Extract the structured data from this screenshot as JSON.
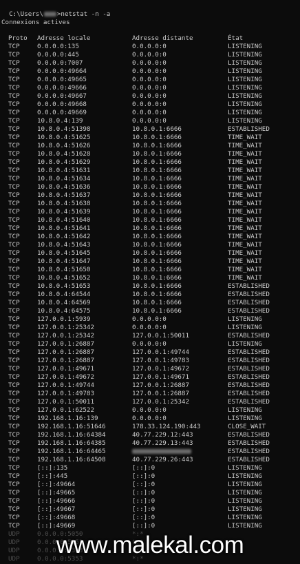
{
  "prompt": {
    "path_start": "C:\\Users\\",
    "path_end": ">",
    "command": "netstat -n -a"
  },
  "section_title": "Connexions actives",
  "headers": {
    "proto": "Proto",
    "local": "Adresse locale",
    "remote": "Adresse distante",
    "state": "État"
  },
  "rows": [
    [
      "TCP",
      "0.0.0.0:135",
      "0.0.0.0:0",
      "LISTENING"
    ],
    [
      "TCP",
      "0.0.0.0:445",
      "0.0.0.0:0",
      "LISTENING"
    ],
    [
      "TCP",
      "0.0.0.0:7007",
      "0.0.0.0:0",
      "LISTENING"
    ],
    [
      "TCP",
      "0.0.0.0:49664",
      "0.0.0.0:0",
      "LISTENING"
    ],
    [
      "TCP",
      "0.0.0.0:49665",
      "0.0.0.0:0",
      "LISTENING"
    ],
    [
      "TCP",
      "0.0.0.0:49666",
      "0.0.0.0:0",
      "LISTENING"
    ],
    [
      "TCP",
      "0.0.0.0:49667",
      "0.0.0.0:0",
      "LISTENING"
    ],
    [
      "TCP",
      "0.0.0.0:49668",
      "0.0.0.0:0",
      "LISTENING"
    ],
    [
      "TCP",
      "0.0.0.0:49669",
      "0.0.0.0:0",
      "LISTENING"
    ],
    [
      "TCP",
      "10.8.0.4:139",
      "0.0.0.0:0",
      "LISTENING"
    ],
    [
      "TCP",
      "10.8.0.4:51398",
      "10.8.0.1:6666",
      "ESTABLISHED"
    ],
    [
      "TCP",
      "10.8.0.4:51625",
      "10.8.0.1:6666",
      "TIME_WAIT"
    ],
    [
      "TCP",
      "10.8.0.4:51626",
      "10.8.0.1:6666",
      "TIME_WAIT"
    ],
    [
      "TCP",
      "10.8.0.4:51628",
      "10.8.0.1:6666",
      "TIME_WAIT"
    ],
    [
      "TCP",
      "10.8.0.4:51629",
      "10.8.0.1:6666",
      "TIME_WAIT"
    ],
    [
      "TCP",
      "10.8.0.4:51631",
      "10.8.0.1:6666",
      "TIME_WAIT"
    ],
    [
      "TCP",
      "10.8.0.4:51634",
      "10.8.0.1:6666",
      "TIME_WAIT"
    ],
    [
      "TCP",
      "10.8.0.4:51636",
      "10.8.0.1:6666",
      "TIME_WAIT"
    ],
    [
      "TCP",
      "10.8.0.4:51637",
      "10.8.0.1:6666",
      "TIME_WAIT"
    ],
    [
      "TCP",
      "10.8.0.4:51638",
      "10.8.0.1:6666",
      "TIME_WAIT"
    ],
    [
      "TCP",
      "10.8.0.4:51639",
      "10.8.0.1:6666",
      "TIME_WAIT"
    ],
    [
      "TCP",
      "10.8.0.4:51640",
      "10.8.0.1:6666",
      "TIME_WAIT"
    ],
    [
      "TCP",
      "10.8.0.4:51641",
      "10.8.0.1:6666",
      "TIME_WAIT"
    ],
    [
      "TCP",
      "10.8.0.4:51642",
      "10.8.0.1:6666",
      "TIME_WAIT"
    ],
    [
      "TCP",
      "10.8.0.4:51643",
      "10.8.0.1:6666",
      "TIME_WAIT"
    ],
    [
      "TCP",
      "10.8.0.4:51645",
      "10.8.0.1:6666",
      "TIME_WAIT"
    ],
    [
      "TCP",
      "10.8.0.4:51647",
      "10.8.0.1:6666",
      "TIME_WAIT"
    ],
    [
      "TCP",
      "10.8.0.4:51650",
      "10.8.0.1:6666",
      "TIME_WAIT"
    ],
    [
      "TCP",
      "10.8.0.4:51652",
      "10.8.0.1:6666",
      "TIME_WAIT"
    ],
    [
      "TCP",
      "10.8.0.4:51653",
      "10.8.0.1:6666",
      "ESTABLISHED"
    ],
    [
      "TCP",
      "10.8.0.4:64544",
      "10.8.0.1:6666",
      "ESTABLISHED"
    ],
    [
      "TCP",
      "10.8.0.4:64569",
      "10.8.0.1:6666",
      "ESTABLISHED"
    ],
    [
      "TCP",
      "10.8.0.4:64575",
      "10.8.0.1:6666",
      "ESTABLISHED"
    ],
    [
      "TCP",
      "127.0.0.1:5939",
      "0.0.0.0:0",
      "LISTENING"
    ],
    [
      "TCP",
      "127.0.0.1:25342",
      "0.0.0.0:0",
      "LISTENING"
    ],
    [
      "TCP",
      "127.0.0.1:25342",
      "127.0.0.1:50011",
      "ESTABLISHED"
    ],
    [
      "TCP",
      "127.0.0.1:26887",
      "0.0.0.0:0",
      "LISTENING"
    ],
    [
      "TCP",
      "127.0.0.1:26887",
      "127.0.0.1:49744",
      "ESTABLISHED"
    ],
    [
      "TCP",
      "127.0.0.1:26887",
      "127.0.0.1:49783",
      "ESTABLISHED"
    ],
    [
      "TCP",
      "127.0.0.1:49671",
      "127.0.0.1:49672",
      "ESTABLISHED"
    ],
    [
      "TCP",
      "127.0.0.1:49672",
      "127.0.0.1:49671",
      "ESTABLISHED"
    ],
    [
      "TCP",
      "127.0.0.1:49744",
      "127.0.0.1:26887",
      "ESTABLISHED"
    ],
    [
      "TCP",
      "127.0.0.1:49783",
      "127.0.0.1:26887",
      "ESTABLISHED"
    ],
    [
      "TCP",
      "127.0.0.1:50011",
      "127.0.0.1:25342",
      "ESTABLISHED"
    ],
    [
      "TCP",
      "127.0.0.1:62522",
      "0.0.0.0:0",
      "LISTENING"
    ],
    [
      "TCP",
      "192.168.1.16:139",
      "0.0.0.0:0",
      "LISTENING"
    ],
    [
      "TCP",
      "192.168.1.16:51646",
      "178.33.124.190:443",
      "CLOSE_WAIT"
    ],
    [
      "TCP",
      "192.168.1.16:64384",
      "40.77.229.12:443",
      "ESTABLISHED"
    ],
    [
      "TCP",
      "192.168.1.16:64385",
      "40.77.229.13:443",
      "ESTABLISHED"
    ],
    [
      "TCP",
      "192.168.1.16:64465",
      "",
      "ESTABLISHED"
    ],
    [
      "TCP",
      "192.168.1.16:64508",
      "40.77.229.26:443",
      "ESTABLISHED"
    ],
    [
      "TCP",
      "[::]:135",
      "[::]:0",
      "LISTENING"
    ],
    [
      "TCP",
      "[::]:445",
      "[::]:0",
      "LISTENING"
    ],
    [
      "TCP",
      "[::]:49664",
      "[::]:0",
      "LISTENING"
    ],
    [
      "TCP",
      "[::]:49665",
      "[::]:0",
      "LISTENING"
    ],
    [
      "TCP",
      "[::]:49666",
      "[::]:0",
      "LISTENING"
    ],
    [
      "TCP",
      "[::]:49667",
      "[::]:0",
      "LISTENING"
    ],
    [
      "TCP",
      "[::]:49668",
      "[::]:0",
      "LISTENING"
    ],
    [
      "TCP",
      "[::]:49669",
      "[::]:0",
      "LISTENING"
    ],
    [
      "UDP",
      "0.0.0.0:5050",
      "*:*",
      ""
    ],
    [
      "UDP",
      "0.0.0.0:5353",
      "*:*",
      ""
    ],
    [
      "UDP",
      "0.0.0.0:5353",
      "*:*",
      ""
    ],
    [
      "UDP",
      "0.0.0.0:5353",
      "*:*",
      ""
    ]
  ],
  "watermark": "www.malekal.com",
  "colors": {
    "background": "#0c0c0c",
    "text": "#cccccc",
    "watermark": "#ffffff"
  }
}
